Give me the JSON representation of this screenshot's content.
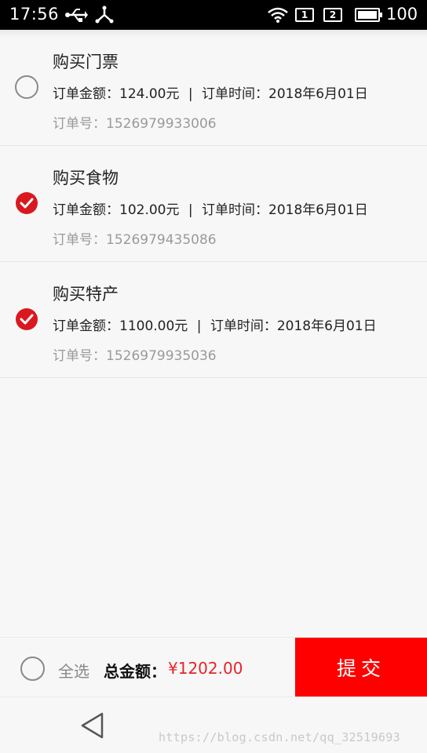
{
  "status_bar": {
    "time": "17:56",
    "sim1": "1",
    "sim2": "2",
    "battery": "100"
  },
  "orders": [
    {
      "title": "购买门票",
      "amount_label": "订单金额：",
      "amount": "124.00元",
      "separator": "|",
      "time_label": "订单时间：",
      "time": "2018年6月01日",
      "no_label": "订单号：",
      "no": "1526979933006",
      "checked": false
    },
    {
      "title": "购买食物",
      "amount_label": "订单金额：",
      "amount": "102.00元",
      "separator": "|",
      "time_label": "订单时间：",
      "time": "2018年6月01日",
      "no_label": "订单号：",
      "no": "1526979435086",
      "checked": true
    },
    {
      "title": "购买特产",
      "amount_label": "订单金额：",
      "amount": "1100.00元",
      "separator": "|",
      "time_label": "订单时间：",
      "time": "2018年6月01日",
      "no_label": "订单号：",
      "no": "1526979935036",
      "checked": true
    }
  ],
  "bottom_bar": {
    "select_all_label": "全选",
    "total_label": "总金额：",
    "total_value": "¥1202.00",
    "submit_label": "提交"
  },
  "watermark": "https://blog.csdn.net/qq_32519693",
  "colors": {
    "accent": "#e8222a",
    "submit_bg": "#ff0000",
    "check_fill": "#d9191f"
  }
}
